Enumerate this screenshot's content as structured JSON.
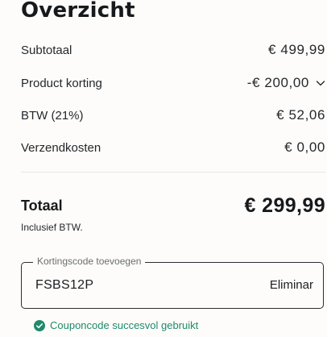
{
  "summary": {
    "title": "Overzicht",
    "rows": [
      {
        "label": "Subtotaal",
        "value": "€ 499,99"
      },
      {
        "label": "Product korting",
        "value": "-€ 200,00"
      },
      {
        "label": "BTW (21%)",
        "value": "€ 52,06"
      },
      {
        "label": "Verzendkosten",
        "value": "€ 0,00"
      }
    ],
    "total": {
      "label": "Totaal",
      "value": "€ 299,99",
      "note": "Inclusief BTW."
    }
  },
  "coupon": {
    "label": "Kortingscode toevoegen",
    "value": "FSBS12P",
    "action_label": "Eliminar",
    "success_message": "Couponcode succesvol gebruikt"
  },
  "colors": {
    "success": "#1f8a6b",
    "text": "#1b1d20",
    "border": "#2b2e33"
  },
  "icons": {
    "discount_toggle": "chevron-down-icon",
    "success": "check-circle-icon"
  }
}
